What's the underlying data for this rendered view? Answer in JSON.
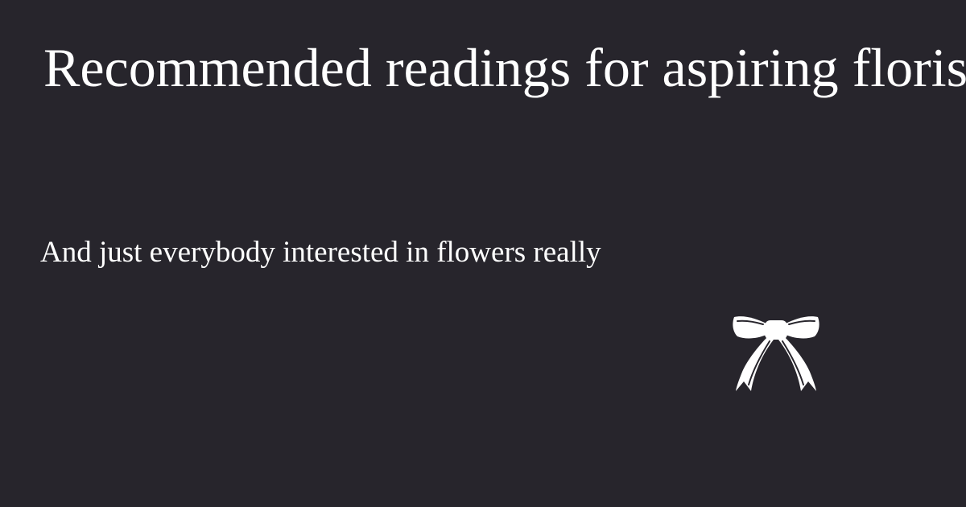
{
  "card": {
    "title": "Recommended readings for aspiring florists",
    "subtitle": "And just everybody interested in flowers really",
    "logo_icon": "ribbon-bow-icon"
  },
  "colors": {
    "background": "#27252c",
    "text": "#ffffff",
    "logo": "#ffffff"
  }
}
